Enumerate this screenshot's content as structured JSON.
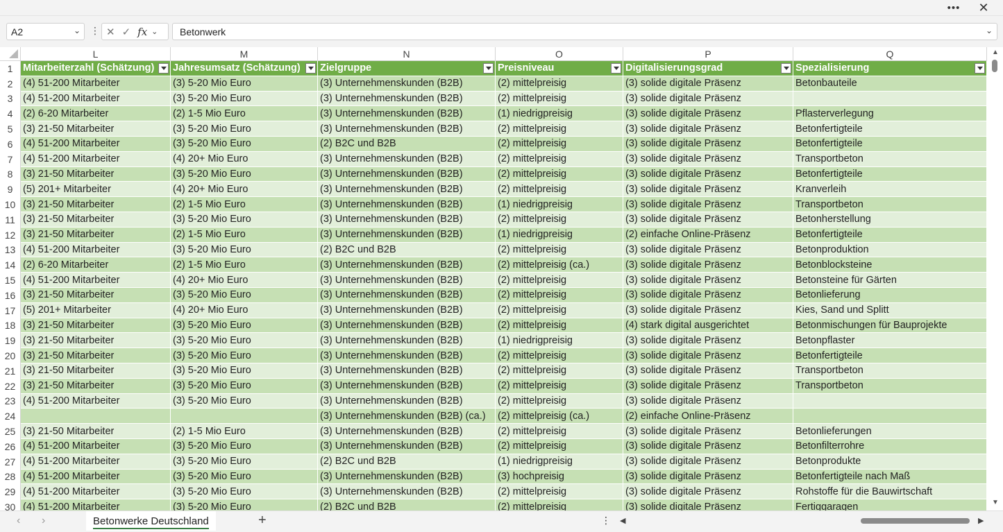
{
  "window": {
    "more_label": "•••",
    "close_label": "✕"
  },
  "formula_bar": {
    "name_box": "A2",
    "formula": "Betonwerk"
  },
  "columns": [
    {
      "letter": "L",
      "header": "Mitarbeiterzahl (Schätzung)"
    },
    {
      "letter": "M",
      "header": "Jahresumsatz (Schätzung)"
    },
    {
      "letter": "N",
      "header": "Zielgruppe"
    },
    {
      "letter": "O",
      "header": "Preisniveau"
    },
    {
      "letter": "P",
      "header": "Digitalisierungsgrad"
    },
    {
      "letter": "Q",
      "header": "Spezialisierung"
    }
  ],
  "rows": [
    {
      "num": "2",
      "cells": [
        "(4) 51-200 Mitarbeiter",
        "(3) 5-20 Mio Euro",
        "(3) Unternehmenskunden (B2B)",
        "(2) mittelpreisig",
        "(3) solide digitale Präsenz",
        "Betonbauteile"
      ]
    },
    {
      "num": "3",
      "cells": [
        "(4) 51-200 Mitarbeiter",
        "(3) 5-20 Mio Euro",
        "(3) Unternehmenskunden (B2B)",
        "(2) mittelpreisig",
        "(3) solide digitale Präsenz",
        ""
      ]
    },
    {
      "num": "4",
      "cells": [
        "(2) 6-20 Mitarbeiter",
        "(2) 1-5 Mio Euro",
        "(3) Unternehmenskunden (B2B)",
        "(1) niedrigpreisig",
        "(3) solide digitale Präsenz",
        "Pflasterverlegung"
      ]
    },
    {
      "num": "5",
      "cells": [
        "(3) 21-50 Mitarbeiter",
        "(3) 5-20 Mio Euro",
        "(3) Unternehmenskunden (B2B)",
        "(2) mittelpreisig",
        "(3) solide digitale Präsenz",
        "Betonfertigteile"
      ]
    },
    {
      "num": "6",
      "cells": [
        "(4) 51-200 Mitarbeiter",
        "(3) 5-20 Mio Euro",
        "(2) B2C und B2B",
        "(2) mittelpreisig",
        "(3) solide digitale Präsenz",
        "Betonfertigteile"
      ]
    },
    {
      "num": "7",
      "cells": [
        "(4) 51-200 Mitarbeiter",
        "(4) 20+ Mio Euro",
        "(3) Unternehmenskunden (B2B)",
        "(2) mittelpreisig",
        "(3) solide digitale Präsenz",
        "Transportbeton"
      ]
    },
    {
      "num": "8",
      "cells": [
        "(3) 21-50 Mitarbeiter",
        "(3) 5-20 Mio Euro",
        "(3) Unternehmenskunden (B2B)",
        "(2) mittelpreisig",
        "(3) solide digitale Präsenz",
        "Betonfertigteile"
      ]
    },
    {
      "num": "9",
      "cells": [
        "(5) 201+ Mitarbeiter",
        "(4) 20+ Mio Euro",
        "(3) Unternehmenskunden (B2B)",
        "(2) mittelpreisig",
        "(3) solide digitale Präsenz",
        "Kranverleih"
      ]
    },
    {
      "num": "10",
      "cells": [
        "(3) 21-50 Mitarbeiter",
        "(2) 1-5 Mio Euro",
        "(3) Unternehmenskunden (B2B)",
        "(1) niedrigpreisig",
        "(3) solide digitale Präsenz",
        "Transportbeton"
      ]
    },
    {
      "num": "11",
      "cells": [
        "(3) 21-50 Mitarbeiter",
        "(3) 5-20 Mio Euro",
        "(3) Unternehmenskunden (B2B)",
        "(2) mittelpreisig",
        "(3) solide digitale Präsenz",
        "Betonherstellung"
      ]
    },
    {
      "num": "12",
      "cells": [
        "(3) 21-50 Mitarbeiter",
        "(2) 1-5 Mio Euro",
        "(3) Unternehmenskunden (B2B)",
        "(1) niedrigpreisig",
        "(2) einfache Online-Präsenz",
        "Betonfertigteile"
      ]
    },
    {
      "num": "13",
      "cells": [
        "(4) 51-200 Mitarbeiter",
        "(3) 5-20 Mio Euro",
        "(2) B2C und B2B",
        "(2) mittelpreisig",
        "(3) solide digitale Präsenz",
        "Betonproduktion"
      ]
    },
    {
      "num": "14",
      "cells": [
        "(2) 6-20 Mitarbeiter",
        "(2) 1-5 Mio Euro",
        "(3) Unternehmenskunden (B2B)",
        "(2) mittelpreisig (ca.)",
        "(3) solide digitale Präsenz",
        "Betonblocksteine"
      ]
    },
    {
      "num": "15",
      "cells": [
        "(4) 51-200 Mitarbeiter",
        "(4) 20+ Mio Euro",
        "(3) Unternehmenskunden (B2B)",
        "(2) mittelpreisig",
        "(3) solide digitale Präsenz",
        "Betonsteine für Gärten"
      ]
    },
    {
      "num": "16",
      "cells": [
        "(3) 21-50 Mitarbeiter",
        "(3) 5-20 Mio Euro",
        "(3) Unternehmenskunden (B2B)",
        "(2) mittelpreisig",
        "(3) solide digitale Präsenz",
        "Betonlieferung"
      ]
    },
    {
      "num": "17",
      "cells": [
        "(5) 201+ Mitarbeiter",
        "(4) 20+ Mio Euro",
        "(3) Unternehmenskunden (B2B)",
        "(2) mittelpreisig",
        "(3) solide digitale Präsenz",
        "Kies, Sand und Splitt"
      ]
    },
    {
      "num": "18",
      "cells": [
        "(3) 21-50 Mitarbeiter",
        "(3) 5-20 Mio Euro",
        "(3) Unternehmenskunden (B2B)",
        "(2) mittelpreisig",
        "(4) stark digital ausgerichtet",
        "Betonmischungen für Bauprojekte"
      ]
    },
    {
      "num": "19",
      "cells": [
        "(3) 21-50 Mitarbeiter",
        "(3) 5-20 Mio Euro",
        "(3) Unternehmenskunden (B2B)",
        "(1) niedrigpreisig",
        "(3) solide digitale Präsenz",
        "Betonpflaster"
      ]
    },
    {
      "num": "20",
      "cells": [
        "(3) 21-50 Mitarbeiter",
        "(3) 5-20 Mio Euro",
        "(3) Unternehmenskunden (B2B)",
        "(2) mittelpreisig",
        "(3) solide digitale Präsenz",
        "Betonfertigteile"
      ]
    },
    {
      "num": "21",
      "cells": [
        "(3) 21-50 Mitarbeiter",
        "(3) 5-20 Mio Euro",
        "(3) Unternehmenskunden (B2B)",
        "(2) mittelpreisig",
        "(3) solide digitale Präsenz",
        "Transportbeton"
      ]
    },
    {
      "num": "22",
      "cells": [
        "(3) 21-50 Mitarbeiter",
        "(3) 5-20 Mio Euro",
        "(3) Unternehmenskunden (B2B)",
        "(2) mittelpreisig",
        "(3) solide digitale Präsenz",
        "Transportbeton"
      ]
    },
    {
      "num": "23",
      "cells": [
        "(4) 51-200 Mitarbeiter",
        "(3) 5-20 Mio Euro",
        "(3) Unternehmenskunden (B2B)",
        "(2) mittelpreisig",
        "(3) solide digitale Präsenz",
        ""
      ]
    },
    {
      "num": "24",
      "cells": [
        "",
        "",
        "(3) Unternehmenskunden (B2B) (ca.)",
        "(2) mittelpreisig (ca.)",
        "(2) einfache Online-Präsenz",
        ""
      ]
    },
    {
      "num": "25",
      "cells": [
        "(3) 21-50 Mitarbeiter",
        "(2) 1-5 Mio Euro",
        "(3) Unternehmenskunden (B2B)",
        "(2) mittelpreisig",
        "(3) solide digitale Präsenz",
        "Betonlieferungen"
      ]
    },
    {
      "num": "26",
      "cells": [
        "(4) 51-200 Mitarbeiter",
        "(3) 5-20 Mio Euro",
        "(3) Unternehmenskunden (B2B)",
        "(2) mittelpreisig",
        "(3) solide digitale Präsenz",
        "Betonfilterrohre"
      ]
    },
    {
      "num": "27",
      "cells": [
        "(4) 51-200 Mitarbeiter",
        "(3) 5-20 Mio Euro",
        "(2) B2C und B2B",
        "(1) niedrigpreisig",
        "(3) solide digitale Präsenz",
        "Betonprodukte"
      ]
    },
    {
      "num": "28",
      "cells": [
        "(4) 51-200 Mitarbeiter",
        "(3) 5-20 Mio Euro",
        "(3) Unternehmenskunden (B2B)",
        "(3) hochpreisig",
        "(3) solide digitale Präsenz",
        "Betonfertigteile nach Maß"
      ]
    },
    {
      "num": "29",
      "cells": [
        "(4) 51-200 Mitarbeiter",
        "(3) 5-20 Mio Euro",
        "(3) Unternehmenskunden (B2B)",
        "(2) mittelpreisig",
        "(3) solide digitale Präsenz",
        "Rohstoffe für die Bauwirtschaft"
      ]
    },
    {
      "num": "30",
      "cells": [
        "(4) 51-200 Mitarbeiter",
        "(3) 5-20 Mio Euro",
        "(2) B2C und B2B",
        "(2) mittelpreisig",
        "(3) solide digitale Präsenz",
        "Fertiggaragen"
      ]
    }
  ],
  "sheet_tabs": [
    {
      "label": "Betonwerke Deutschland",
      "active": true
    }
  ],
  "add_sheet_label": "+",
  "colors": {
    "header": "#70ad47",
    "band_dark": "#c6e0b4",
    "band_light": "#e2efda",
    "tab_underline": "#3a7d44"
  }
}
